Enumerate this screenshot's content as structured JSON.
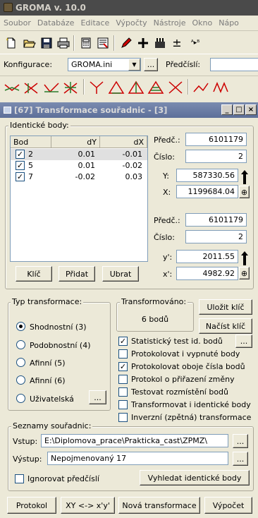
{
  "app": {
    "title": "GROMA v. 10.0"
  },
  "menu": [
    "Soubor",
    "Databáze",
    "Editace",
    "Výpočty",
    "Nástroje",
    "Okno",
    "Nápo"
  ],
  "toolbar": {
    "pm_symbol": "±",
    "ab_symbol": "ᴬ▸ᴮ"
  },
  "config": {
    "label": "Konfigurace:",
    "value": "GROMA.ini",
    "ellipsis": "...",
    "predcisli_label": "Předčíslí:",
    "predcisli_value": ""
  },
  "window": {
    "title": "[67] Transformace souřadnic - [3]",
    "min": "_",
    "max": "□",
    "close": "×"
  },
  "identical": {
    "group_label": "Identické body:",
    "columns": [
      "Bod",
      "dY",
      "dX"
    ],
    "rows": [
      {
        "bod": "2",
        "dy": "0.01",
        "dx": "-0.01",
        "checked": true
      },
      {
        "bod": "5",
        "dy": "0.01",
        "dx": "-0.02",
        "checked": true
      },
      {
        "bod": "7",
        "dy": "-0.02",
        "dx": "0.03",
        "checked": true
      }
    ],
    "check_mark": "✓",
    "btn_key": "Klíč",
    "btn_add": "Přidat",
    "btn_remove": "Ubrat"
  },
  "coords": {
    "predc_label": "Předč.:",
    "predc_value": "6101179",
    "cislo_label": "Číslo:",
    "cislo_value": "2",
    "y_label": "Y:",
    "y_value": "587330.56",
    "x_label": "X:",
    "x_value": "1199684.04",
    "predc2_label": "Předč.:",
    "predc2_value": "6101179",
    "cislo2_label": "Číslo:",
    "cislo2_value": "2",
    "y2_label": "y':",
    "y2_value": "2011.55",
    "x2_label": "x':",
    "x2_value": "4982.92"
  },
  "transform_type": {
    "group_label": "Typ transformace:",
    "options": [
      {
        "label": "Shodnostní (3)",
        "selected": true
      },
      {
        "label": "Podobnostní (4)",
        "selected": false
      },
      {
        "label": "Afinní (5)",
        "selected": false
      },
      {
        "label": "Afinní (6)",
        "selected": false
      },
      {
        "label": "Uživatelská",
        "selected": false
      }
    ],
    "user_btn": "..."
  },
  "transformed": {
    "group_label": "Transformováno:",
    "count_text": "6 bodů",
    "save_key": "Uložit klíč",
    "load_key": "Načíst klíč"
  },
  "options": [
    {
      "label": "Statistický test id. bodů",
      "checked": true
    },
    {
      "label": "Protokolovat i vypnuté body",
      "checked": false
    },
    {
      "label": "Protokolovat oboje čísla bodů",
      "checked": true
    },
    {
      "label": "Protokol o přiřazení změny",
      "checked": false
    },
    {
      "label": "Testovat rozmístění bodů",
      "checked": false
    },
    {
      "label": "Transformovat i identické body",
      "checked": false
    },
    {
      "label": "Inverzní (zpětná) transformace",
      "checked": false
    }
  ],
  "options_btn": "...",
  "lists": {
    "group_label": "Seznamy souřadnic:",
    "input_label": "Vstup:",
    "input_value": "E:\\Diplomova_prace\\Prakticka_cast\\ZPMZ\\",
    "output_label": "Výstup:",
    "output_value": "Nepojmenovaný 17",
    "ignore_label": "Ignorovat předčíslí",
    "find_btn": "Vyhledat identické body",
    "browse": "..."
  },
  "footer": {
    "protocol": "Protokol",
    "swap": "XY <-> x'y'",
    "new": "Nová transformace",
    "compute": "Výpočet"
  }
}
